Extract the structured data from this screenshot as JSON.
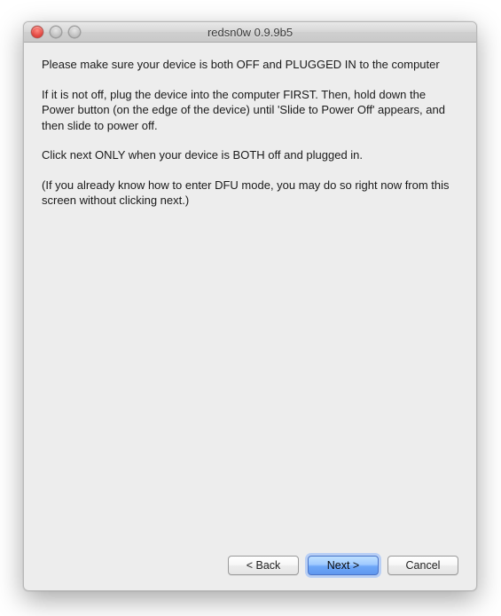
{
  "window": {
    "title": "redsn0w 0.9.9b5"
  },
  "content": {
    "p1": "Please make sure your device is both OFF and PLUGGED IN to the computer",
    "p2": "If it is not off, plug the device into the computer FIRST. Then, hold down the Power button (on the edge of the device) until 'Slide to Power Off' appears, and then slide to power off.",
    "p3": "Click next ONLY when your device is BOTH off and plugged in.",
    "p4": "(If you already know how to enter DFU mode, you may do so right now from this screen without clicking next.)"
  },
  "buttons": {
    "back": "< Back",
    "next": "Next >",
    "cancel": "Cancel"
  }
}
